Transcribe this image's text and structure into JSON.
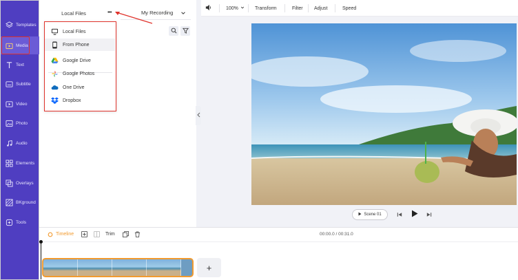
{
  "sidebar": {
    "items": [
      {
        "label": "Templates",
        "icon": "layers-icon"
      },
      {
        "label": "Media",
        "icon": "media-folder-icon"
      },
      {
        "label": "Text",
        "icon": "text-icon"
      },
      {
        "label": "Subtitle",
        "icon": "subtitle-icon"
      },
      {
        "label": "Video",
        "icon": "video-icon"
      },
      {
        "label": "Photo",
        "icon": "photo-icon"
      },
      {
        "label": "Audio",
        "icon": "music-note-icon"
      },
      {
        "label": "Elements",
        "icon": "elements-icon"
      },
      {
        "label": "Overlays",
        "icon": "overlays-icon"
      },
      {
        "label": "BKground",
        "icon": "background-icon"
      },
      {
        "label": "Tools",
        "icon": "tools-icon"
      }
    ],
    "active": "Media"
  },
  "panel": {
    "tab_local": "Local Files",
    "tab_recording": "My Recording",
    "more_label": "•••"
  },
  "dropdown": {
    "items": [
      {
        "label": "Local Files",
        "icon": "monitor-icon"
      },
      {
        "label": "From Phone",
        "icon": "phone-icon"
      },
      {
        "label": "Google Drive",
        "icon": "google-drive-icon"
      },
      {
        "label": "Google Photos",
        "icon": "google-photos-icon"
      },
      {
        "label": "One Drive",
        "icon": "onedrive-icon"
      },
      {
        "label": "Dropbox",
        "icon": "dropbox-icon"
      }
    ],
    "highlighted": "From Phone"
  },
  "toolbar": {
    "zoom": "100%",
    "transform": "Transform",
    "filter": "Filter",
    "adjust": "Adjust",
    "speed": "Speed"
  },
  "player": {
    "scene_label": "Scene  01"
  },
  "timeline": {
    "label": "Timeline",
    "trim": "Trim",
    "time": "00:00.0 / 00:31.0",
    "add": "+"
  },
  "colors": {
    "sidebar_bg": "#4f3ec1",
    "accent_orange": "#f29a2e",
    "highlight_red": "#e0322b"
  }
}
